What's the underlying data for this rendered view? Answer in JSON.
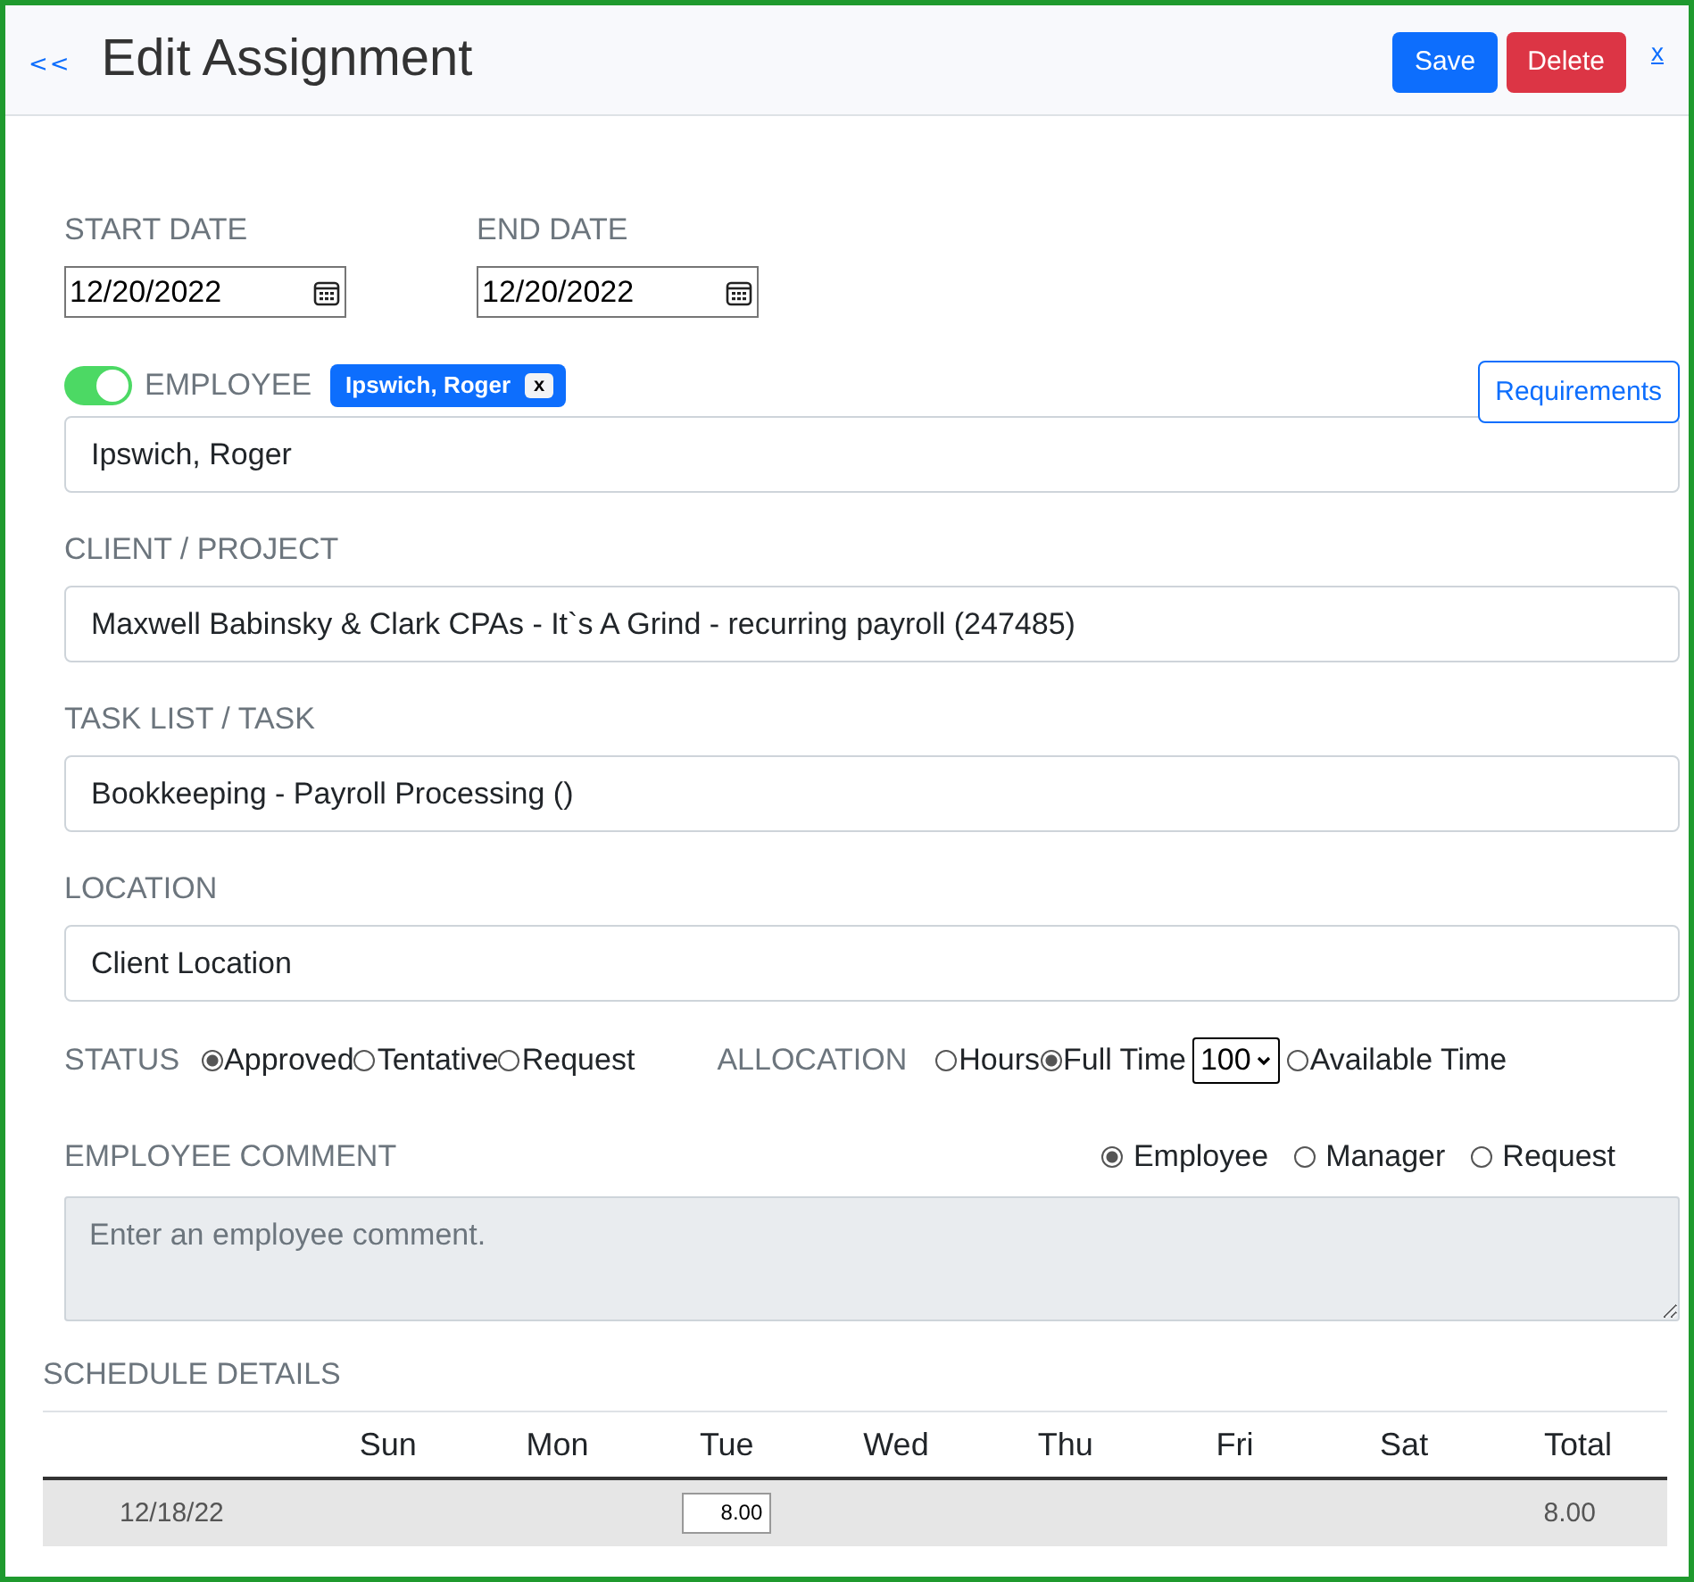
{
  "header": {
    "back": "<<",
    "title": "Edit Assignment",
    "buttons": [
      {
        "label": "Save",
        "kind": "primary"
      },
      {
        "label": "Delete",
        "kind": "danger"
      }
    ],
    "close": "x"
  },
  "dates": [
    {
      "label": "START DATE",
      "value": "12/20/2022"
    },
    {
      "label": "END DATE",
      "value": "12/20/2022"
    }
  ],
  "employee": {
    "on": true,
    "label": "EMPLOYEE",
    "chip": {
      "label": "Ipswich, Roger",
      "remove": "x"
    },
    "requirements": "Requirements",
    "value": "Ipswich, Roger"
  },
  "fields": [
    {
      "label": "CLIENT / PROJECT",
      "value": "Maxwell Babinsky & Clark CPAs - It`s A Grind - recurring payroll (247485)"
    },
    {
      "label": "TASK LIST / TASK",
      "value": "Bookkeeping - Payroll Processing ()"
    },
    {
      "label": "LOCATION",
      "value": "Client Location"
    }
  ],
  "status": {
    "label": "STATUS",
    "options": [
      {
        "label": "Approved",
        "selected": true
      },
      {
        "label": "Tentative",
        "selected": false
      },
      {
        "label": "Request",
        "selected": false
      }
    ]
  },
  "allocation": {
    "label": "ALLOCATION",
    "options": [
      {
        "label": "Hours",
        "selected": false
      },
      {
        "label": "Full Time",
        "selected": true,
        "percent": "100"
      },
      {
        "label": "Available Time",
        "selected": false
      }
    ]
  },
  "comment": {
    "label": "EMPLOYEE COMMENT",
    "audience": [
      {
        "label": "Employee",
        "selected": true
      },
      {
        "label": "Manager",
        "selected": false
      },
      {
        "label": "Request",
        "selected": false
      }
    ],
    "placeholder": "Enter an employee comment."
  },
  "schedule": {
    "title": "SCHEDULE DETAILS",
    "columns": [
      "Sun",
      "Mon",
      "Tue",
      "Wed",
      "Thu",
      "Fri",
      "Sat",
      "Total"
    ],
    "rows": [
      {
        "week": "12/18/22",
        "days": [
          {
            "kind": "blank"
          },
          {
            "kind": "blank"
          },
          {
            "kind": "input",
            "value": "8.00"
          },
          {
            "kind": "blank"
          },
          {
            "kind": "blank"
          },
          {
            "kind": "blank"
          },
          {
            "kind": "blank"
          }
        ],
        "total": "8.00"
      }
    ]
  }
}
